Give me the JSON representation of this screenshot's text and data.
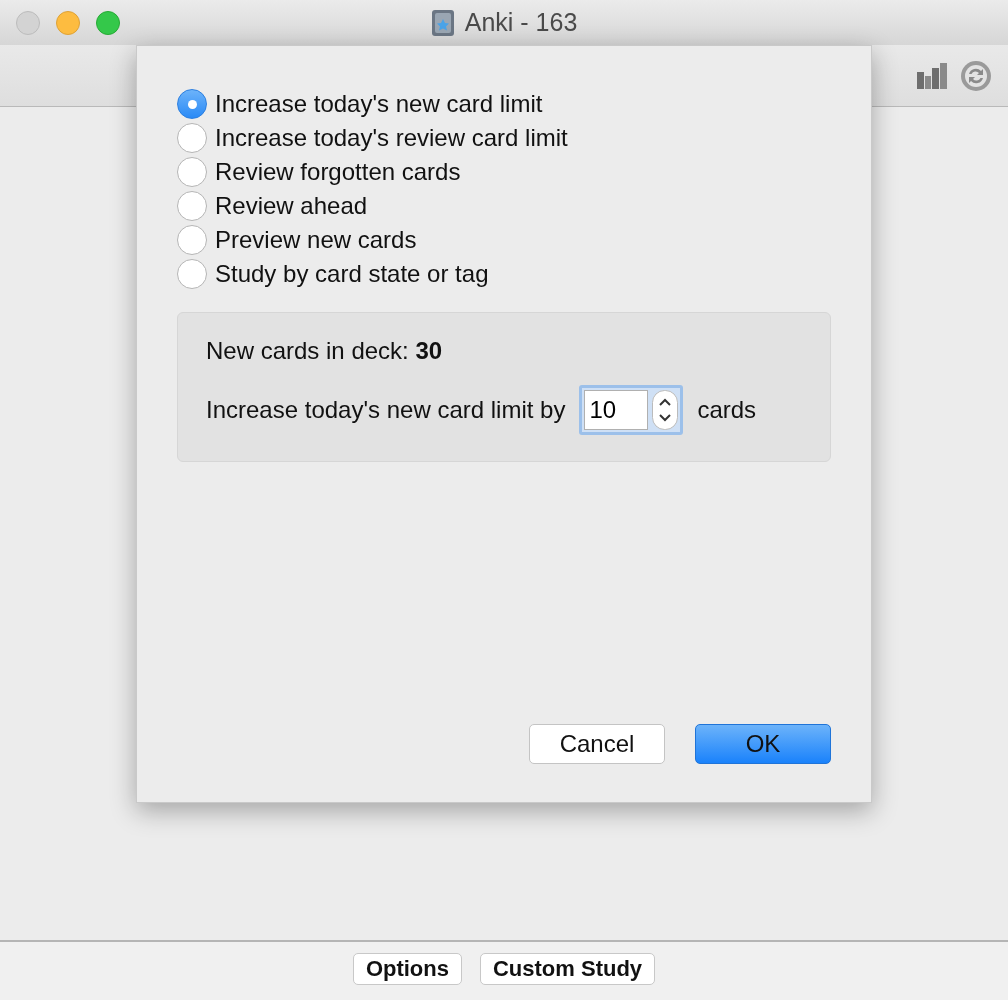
{
  "window": {
    "title": "Anki - 163"
  },
  "dialog": {
    "options": [
      {
        "label": "Increase today's new card limit",
        "selected": true
      },
      {
        "label": "Increase today's review card limit",
        "selected": false
      },
      {
        "label": "Review forgotten cards",
        "selected": false
      },
      {
        "label": "Review ahead",
        "selected": false
      },
      {
        "label": "Preview new cards",
        "selected": false
      },
      {
        "label": "Study by card state or tag",
        "selected": false
      }
    ],
    "panel": {
      "deck_info": "New cards in deck: **30**",
      "limit_label": "Increase today's new card limit by",
      "limit_value": "10",
      "unit": "cards"
    },
    "buttons": [
      {
        "label": "Cancel",
        "kind": "default"
      },
      {
        "label": "OK",
        "kind": "primary"
      }
    ]
  },
  "bottom_bar": {
    "buttons": [
      "Options",
      "Custom Study"
    ]
  }
}
